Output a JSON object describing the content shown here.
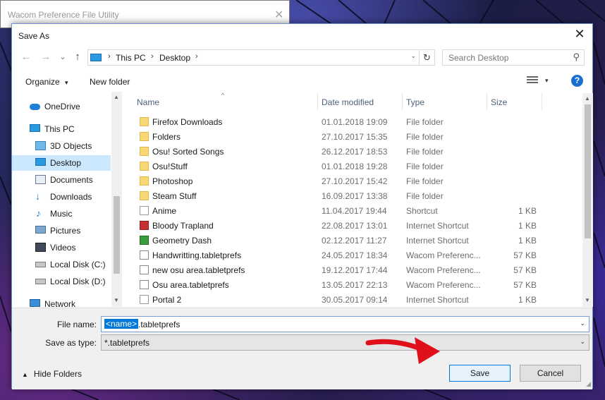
{
  "parent_window": {
    "title": "Wacom Preference File Utility",
    "close_glyph": "✕"
  },
  "dialog": {
    "title": "Save As",
    "close_glyph": "✕"
  },
  "navigation": {
    "back_glyph": "←",
    "forward_glyph": "→",
    "recent_glyph": "⌄",
    "up_glyph": "↑",
    "breadcrumbs": [
      "This PC",
      "Desktop"
    ],
    "separator_glyph": "›",
    "dropdown_glyph": "⌄",
    "refresh_glyph": "↻",
    "search_placeholder": "Search Desktop",
    "search_glyph": "⚲"
  },
  "toolbar": {
    "organize_label": "Organize",
    "organize_glyph": "▾",
    "new_folder_label": "New folder",
    "view_dropdown_glyph": "▾",
    "help_glyph": "?"
  },
  "sidebar": {
    "items": [
      {
        "label": "OneDrive",
        "icon": "cloud-icon",
        "selected": false
      },
      {
        "label": "This PC",
        "icon": "computer-icon",
        "selected": false
      },
      {
        "label": "3D Objects",
        "icon": "cube-icon",
        "selected": false
      },
      {
        "label": "Desktop",
        "icon": "desktop-icon",
        "selected": true
      },
      {
        "label": "Documents",
        "icon": "documents-icon",
        "selected": false
      },
      {
        "label": "Downloads",
        "icon": "download-icon",
        "selected": false
      },
      {
        "label": "Music",
        "icon": "music-icon",
        "selected": false
      },
      {
        "label": "Pictures",
        "icon": "pictures-icon",
        "selected": false
      },
      {
        "label": "Videos",
        "icon": "videos-icon",
        "selected": false
      },
      {
        "label": "Local Disk (C:)",
        "icon": "drive-icon",
        "selected": false
      },
      {
        "label": "Local Disk (D:)",
        "icon": "drive-icon",
        "selected": false
      },
      {
        "label": "Network",
        "icon": "network-icon",
        "selected": false
      }
    ],
    "scroll_up_glyph": "▲",
    "scroll_down_glyph": "▼"
  },
  "file_list": {
    "sort_glyph": "^",
    "columns": [
      "Name",
      "Date modified",
      "Type",
      "Size"
    ],
    "rows": [
      {
        "name": "Firefox Downloads",
        "date": "01.01.2018 19:09",
        "type": "File folder",
        "size": "",
        "icon": "folder-icon"
      },
      {
        "name": "Folders",
        "date": "27.10.2017 15:35",
        "type": "File folder",
        "size": "",
        "icon": "folder-icon"
      },
      {
        "name": "Osu! Sorted Songs",
        "date": "26.12.2017 18:53",
        "type": "File folder",
        "size": "",
        "icon": "folder-icon"
      },
      {
        "name": "Osu!Stuff",
        "date": "01.01.2018 19:28",
        "type": "File folder",
        "size": "",
        "icon": "folder-icon"
      },
      {
        "name": "Photoshop",
        "date": "27.10.2017 15:42",
        "type": "File folder",
        "size": "",
        "icon": "folder-icon"
      },
      {
        "name": "Steam Stuff",
        "date": "16.09.2017 13:38",
        "type": "File folder",
        "size": "",
        "icon": "folder-icon"
      },
      {
        "name": "Anime",
        "date": "11.04.2017 19:44",
        "type": "Shortcut",
        "size": "1 KB",
        "icon": "shortcut-icon"
      },
      {
        "name": "Bloody Trapland",
        "date": "22.08.2017 13:01",
        "type": "Internet Shortcut",
        "size": "1 KB",
        "icon": "game-icon"
      },
      {
        "name": "Geometry Dash",
        "date": "02.12.2017 11:27",
        "type": "Internet Shortcut",
        "size": "1 KB",
        "icon": "game-icon"
      },
      {
        "name": "Handwritting.tabletprefs",
        "date": "24.05.2017 18:34",
        "type": "Wacom Preferenc...",
        "size": "57 KB",
        "icon": "file-icon"
      },
      {
        "name": "new osu area.tabletprefs",
        "date": "19.12.2017 17:44",
        "type": "Wacom Preferenc...",
        "size": "57 KB",
        "icon": "file-icon"
      },
      {
        "name": "Osu area.tabletprefs",
        "date": "13.05.2017 22:13",
        "type": "Wacom Preferenc...",
        "size": "57 KB",
        "icon": "file-icon"
      },
      {
        "name": "Portal 2",
        "date": "30.05.2017 09:14",
        "type": "Internet Shortcut",
        "size": "1 KB",
        "icon": "game-icon"
      }
    ],
    "scroll_up_glyph": "▲",
    "scroll_down_glyph": "▼"
  },
  "form": {
    "file_name_label": "File name:",
    "file_name_selected": "<name>",
    "file_name_rest": ".tabletprefs",
    "save_type_label": "Save as type:",
    "save_type_value": "*.tabletprefs",
    "dropdown_glyph": "⌄",
    "hide_folders_label": "Hide Folders",
    "hide_folders_glyph": "▲",
    "save_label": "Save",
    "cancel_label": "Cancel"
  },
  "colors": {
    "accent": "#0078d7",
    "selection": "#cce8ff",
    "annotation_arrow": "#e0101a"
  }
}
